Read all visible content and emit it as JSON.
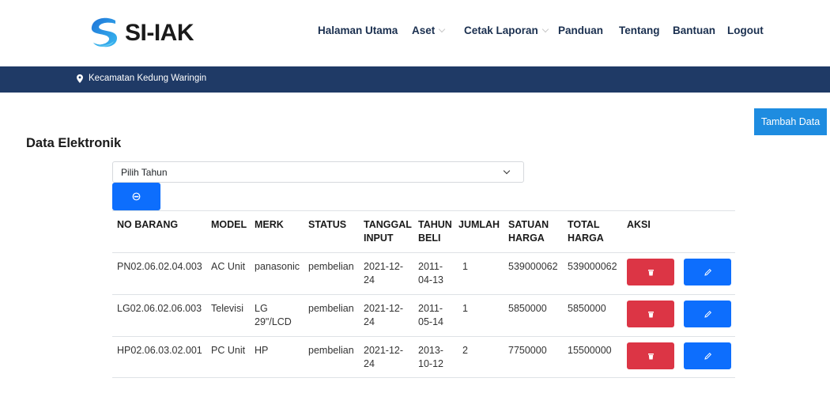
{
  "brand": {
    "name": "SI-IAK",
    "logo_icon": "s-swoosh-logo-icon",
    "colors": {
      "primary": "#0d6efd",
      "danger": "#dc3545",
      "navbar": "#1f3a66",
      "add_button": "#1e8ce0"
    }
  },
  "nav": {
    "items": [
      {
        "label": "Halaman Utama",
        "dropdown": false
      },
      {
        "label": "Aset",
        "dropdown": true
      },
      {
        "label": "Cetak Laporan",
        "dropdown": true
      },
      {
        "label": "Panduan",
        "dropdown": false
      },
      {
        "label": "Tentang",
        "dropdown": false
      },
      {
        "label": "Bantuan",
        "dropdown": false
      },
      {
        "label": "Logout",
        "dropdown": false
      }
    ]
  },
  "location": {
    "icon": "map-pin-icon",
    "label": "Kecamatan Kedung Waringin"
  },
  "main": {
    "add_button": "Tambah Data",
    "title": "Data Elektronik",
    "year_select": {
      "value": "Pilih Tahun"
    },
    "print_icon": "print-icon"
  },
  "table": {
    "headers": [
      [
        "NO BARANG"
      ],
      [
        "MODEL"
      ],
      [
        "MERK"
      ],
      [
        "STATUS"
      ],
      [
        "TANGGAL",
        "INPUT"
      ],
      [
        "TAHUN",
        "BELI"
      ],
      [
        "JUMLAH"
      ],
      [
        "SATUAN",
        "HARGA"
      ],
      [
        "TOTAL",
        "HARGA"
      ],
      [
        "AKSI"
      ]
    ],
    "rows": [
      {
        "no_barang": "PN02.06.02.04.003",
        "model": "AC Unit",
        "merk": [
          "panasonic"
        ],
        "status": "pembelian",
        "tanggal_input": [
          "2021-12-",
          "24"
        ],
        "tahun_beli": [
          "2011-",
          "04-13"
        ],
        "jumlah": "1",
        "satuan_harga": "539000062",
        "total_harga": "539000062"
      },
      {
        "no_barang": "LG02.06.02.06.003",
        "model": "Televisi",
        "merk": [
          "LG",
          "29\"/LCD"
        ],
        "status": "pembelian",
        "tanggal_input": [
          "2021-12-",
          "24"
        ],
        "tahun_beli": [
          "2011-",
          "05-14"
        ],
        "jumlah": "1",
        "satuan_harga": "5850000",
        "total_harga": "5850000"
      },
      {
        "no_barang": "HP02.06.03.02.001",
        "model": "PC Unit",
        "merk": [
          "HP"
        ],
        "status": "pembelian",
        "tanggal_input": [
          "2021-12-",
          "24"
        ],
        "tahun_beli": [
          "2013-",
          "10-12"
        ],
        "jumlah": "2",
        "satuan_harga": "7750000",
        "total_harga": "15500000"
      }
    ],
    "action_icons": {
      "delete": "trash-icon",
      "edit": "pencil-icon"
    }
  }
}
